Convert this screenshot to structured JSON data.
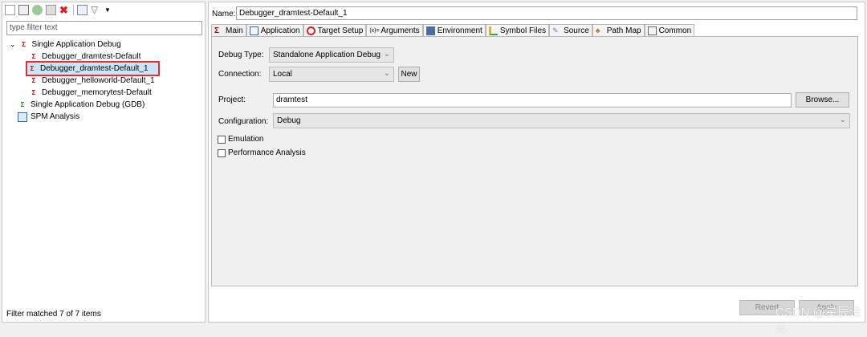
{
  "toolbar": {
    "icons": [
      "new-config-icon",
      "new-prototype-icon",
      "link-icon",
      "duplicate-icon",
      "delete-icon",
      "collapse-all-icon",
      "filter-icon",
      "dropdown-icon"
    ]
  },
  "filter": {
    "placeholder": "type filter text"
  },
  "tree": {
    "group1": "Single Application Debug",
    "children": [
      "Debugger_dramtest-Default",
      "Debugger_dramtest-Default_1",
      "Debugger_helloworld-Default_1",
      "Debugger_memorytest-Default"
    ],
    "group2": "Single Application Debug (GDB)",
    "group3": "SPM Analysis"
  },
  "status": "Filter matched 7 of 7 items",
  "name": {
    "label": "Name:",
    "value": "Debugger_dramtest-Default_1"
  },
  "tabs": [
    "Main",
    "Application",
    "Target Setup",
    "Arguments",
    "Environment",
    "Symbol Files",
    "Source",
    "Path Map",
    "Common"
  ],
  "main": {
    "debug_type_label": "Debug Type:",
    "debug_type_value": "Standalone Application Debug",
    "connection_label": "Connection:",
    "connection_value": "Local",
    "new_label": "New",
    "project_label": "Project:",
    "project_value": "dramtest",
    "browse_label": "Browse...",
    "configuration_label": "Configuration:",
    "configuration_value": "Debug",
    "emulation_label": "Emulation",
    "performance_label": "Performance Analysis"
  },
  "buttons": {
    "revert": "Revert",
    "apply": "Apply"
  },
  "watermark": "CSDN @星辰法斗",
  "colors": {
    "selection": "#cce4f7",
    "highlight_box": "#e03030"
  }
}
